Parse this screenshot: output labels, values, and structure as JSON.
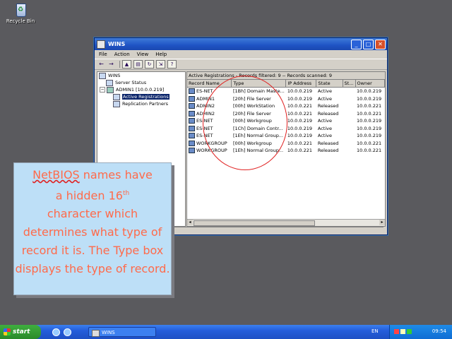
{
  "desktop": {
    "recycle_bin_label": "Recycle Bin"
  },
  "window": {
    "title": "WINS",
    "menu": [
      "File",
      "Action",
      "View",
      "Help"
    ],
    "tree": [
      {
        "label": "WINS",
        "icon": "wins-icon"
      },
      {
        "label": "Server Status",
        "icon": "server-status-icon"
      },
      {
        "label": "ADMIN1 [10.0.0.219]",
        "icon": "computer-icon"
      },
      {
        "label": "Active Registrations",
        "icon": "folder-icon",
        "selected": true
      },
      {
        "label": "Replication Partners",
        "icon": "folder-icon"
      }
    ],
    "status_header": "Active Registrations - Records filtered: 9 -- Records scanned: 9",
    "columns": [
      "Record Name",
      "Type",
      "IP Address",
      "State",
      "St...",
      "Owner"
    ],
    "rows": [
      [
        "ES-NET",
        "[1Bh] Domain Maste...",
        "10.0.0.219",
        "Active",
        "",
        "10.0.0.219"
      ],
      [
        "ADMIN1",
        "[20h] File Server",
        "10.0.0.219",
        "Active",
        "",
        "10.0.0.219"
      ],
      [
        "ADMIN2",
        "[00h] WorkStation",
        "10.0.0.221",
        "Released",
        "",
        "10.0.0.221"
      ],
      [
        "ADMIN2",
        "[20h] File Server",
        "10.0.0.221",
        "Released",
        "",
        "10.0.0.221"
      ],
      [
        "ES-NET",
        "[00h] Workgroup",
        "10.0.0.219",
        "Active",
        "",
        "10.0.0.219"
      ],
      [
        "ES-NET",
        "[1Ch] Domain Contr...",
        "10.0.0.219",
        "Active",
        "",
        "10.0.0.219"
      ],
      [
        "ES-NET",
        "[1Eh] Normal Group...",
        "10.0.0.219",
        "Active",
        "",
        "10.0.0.219"
      ],
      [
        "WORKGROUP",
        "[00h] Workgroup",
        "10.0.0.221",
        "Released",
        "",
        "10.0.0.221"
      ],
      [
        "WORKGROUP",
        "[1Eh] Normal Group...",
        "10.0.0.221",
        "Released",
        "",
        "10.0.0.221"
      ]
    ]
  },
  "callout": {
    "line1_word": "NetBIOS",
    "line1_rest": " names have",
    "line2_pre": "a hidden 16",
    "line2_sup": "th",
    "rest": "character which determines what type of record it is. The Type box displays the type of record."
  },
  "taskbar": {
    "start_label": "start",
    "task_label": "WINS",
    "language": "EN",
    "clock": "09:54"
  },
  "colors": {
    "callout_text": "#ff6a4a",
    "callout_bg": "#bddff7",
    "highlight_circle": "#e02020"
  }
}
